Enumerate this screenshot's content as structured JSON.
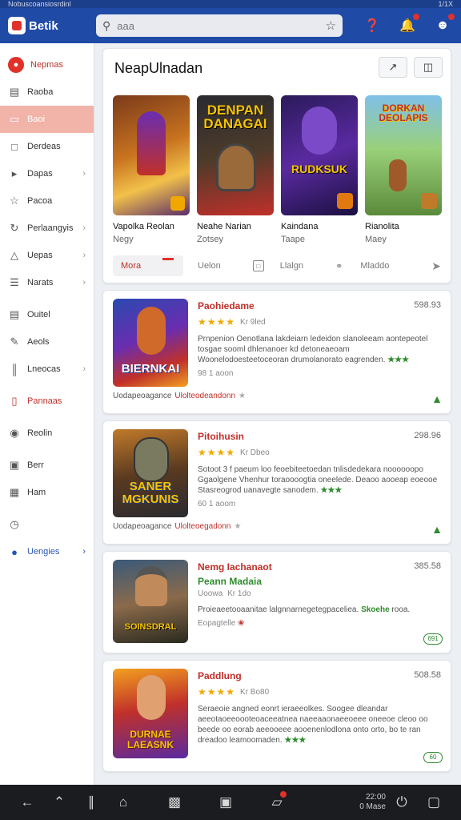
{
  "status_bar": {
    "left_text": "Nobuscoansiosrdinl",
    "right_text": "1/1X"
  },
  "app": {
    "name": "Betik"
  },
  "search": {
    "placeholder": "aaa"
  },
  "sidebar": {
    "items": [
      {
        "label": "Nepmas",
        "icon": "home-icon"
      },
      {
        "label": "Raoba",
        "icon": "news-icon"
      },
      {
        "label": "Baoi",
        "icon": "tag-icon"
      },
      {
        "label": "Derdeas",
        "icon": "folder-icon"
      },
      {
        "label": "Dapas",
        "icon": "tag-icon"
      },
      {
        "label": "Pacoa",
        "icon": "star-icon"
      },
      {
        "label": "Perlaangyis",
        "icon": "sync-icon"
      },
      {
        "label": "Uepas",
        "icon": "triangle-icon"
      },
      {
        "label": "Narats",
        "icon": "list-icon"
      },
      {
        "label": "Ouitel",
        "icon": "document-icon"
      },
      {
        "label": "Aeols",
        "icon": "pencil-icon"
      },
      {
        "label": "Lneocas",
        "icon": "bars-icon"
      },
      {
        "label": "Pannaas",
        "icon": "bookmark-icon"
      },
      {
        "label": "Reolin",
        "icon": "shield-icon"
      },
      {
        "label": "Berr",
        "icon": "image-icon"
      },
      {
        "label": "Ham",
        "icon": "chart-icon"
      },
      {
        "label": "",
        "icon": "clock-icon"
      },
      {
        "label": "Uengies",
        "icon": "globe-icon"
      }
    ]
  },
  "featured": {
    "title": "NeapUlnadan",
    "tiles": [
      {
        "art_text": "",
        "name": "Vapolka Reolan",
        "sub": "Negy"
      },
      {
        "art_text": "DENPAN DANAGAI",
        "name": "Neahe Narian",
        "sub": "Zotsey"
      },
      {
        "art_text": "RUDKSUK",
        "name": "Kaindana",
        "sub": "Taape"
      },
      {
        "art_text": "DORKAN DEOLAPIS",
        "name": "Rianolita",
        "sub": "Maey"
      }
    ],
    "footer": {
      "tab1": "Mora",
      "tab2": "Uelon",
      "tab3": "Llalgn",
      "tab4": "Mladdo"
    }
  },
  "games": [
    {
      "title": "Paohiedame",
      "sub": "",
      "price": "598.93",
      "rating_label": "Kr 9led",
      "art_text": "BIERNKAI",
      "desc": "Prnpenion Oenotlana lakdeiarn ledeidon slanoleeam aontepeotel tosgae sooml dhlenanoer kd detoneaeoam Woonelodoesteetoceoran drumolanorato eagrenden.",
      "desc_green": "★★★",
      "meta": "98 1 aoon",
      "foot_a": "Uodapeoagance",
      "foot_b": "Ulolteodeandonn",
      "foot_c": "★"
    },
    {
      "title": "Pitoihusin",
      "sub": "",
      "price": "298.96",
      "rating_label": "Kr Dbeo",
      "art_text": "SANER MGKUNIS",
      "desc": "Sotoot 3 f paeum loo feoebiteetoedan tnlisdedekara noooooopo Ggaolgene Vhenhur toraoooogtia oneelede. Deaoo aooeap eoeooe Stasreogrod uanavegte sanodem.",
      "desc_green": "★★★",
      "meta": "60 1 aoom",
      "foot_a": "Uodapeoagance",
      "foot_b": "Ulolteoegadonn",
      "foot_c": "★"
    },
    {
      "title": "Nemg Iachanaot",
      "sub": "Peann Madaia",
      "price": "385.58",
      "rating_label": "Kr 1do",
      "rating_prefix": "Uoowa",
      "art_text": "SOINSDRAL",
      "desc": "Proieaeetooaanitae lalgnnarnegetegpaceliea.",
      "desc_green": "Skoehe",
      "desc_tail": "rooa.",
      "meta": "Eopagtelle",
      "badge": "691"
    },
    {
      "title": "Paddlung",
      "sub": "",
      "price": "508.58",
      "rating_label": "Kr Bo80",
      "art_text": "DURNAE LAEASNK",
      "desc": "Seraeoie angned eonrt ieraeeolkes. Soogee dleandar aeeotaoeeoooteoaceeatnea naeeaaonaeeoeee oneeoe cleoo oo beede oo eorab aeeooeee aooenenlodlona onto orto, bo te ran dreadoo leamoomaden.",
      "desc_green": "★★★",
      "meta": "",
      "badge": "60"
    }
  ],
  "bottom_nav": {
    "time": "22:00",
    "sub_time": "0 Mase"
  },
  "colors": {
    "brand": "#1f4aa6",
    "accent": "#e0312b",
    "green": "#2e8b2e",
    "star": "#f0a800"
  }
}
